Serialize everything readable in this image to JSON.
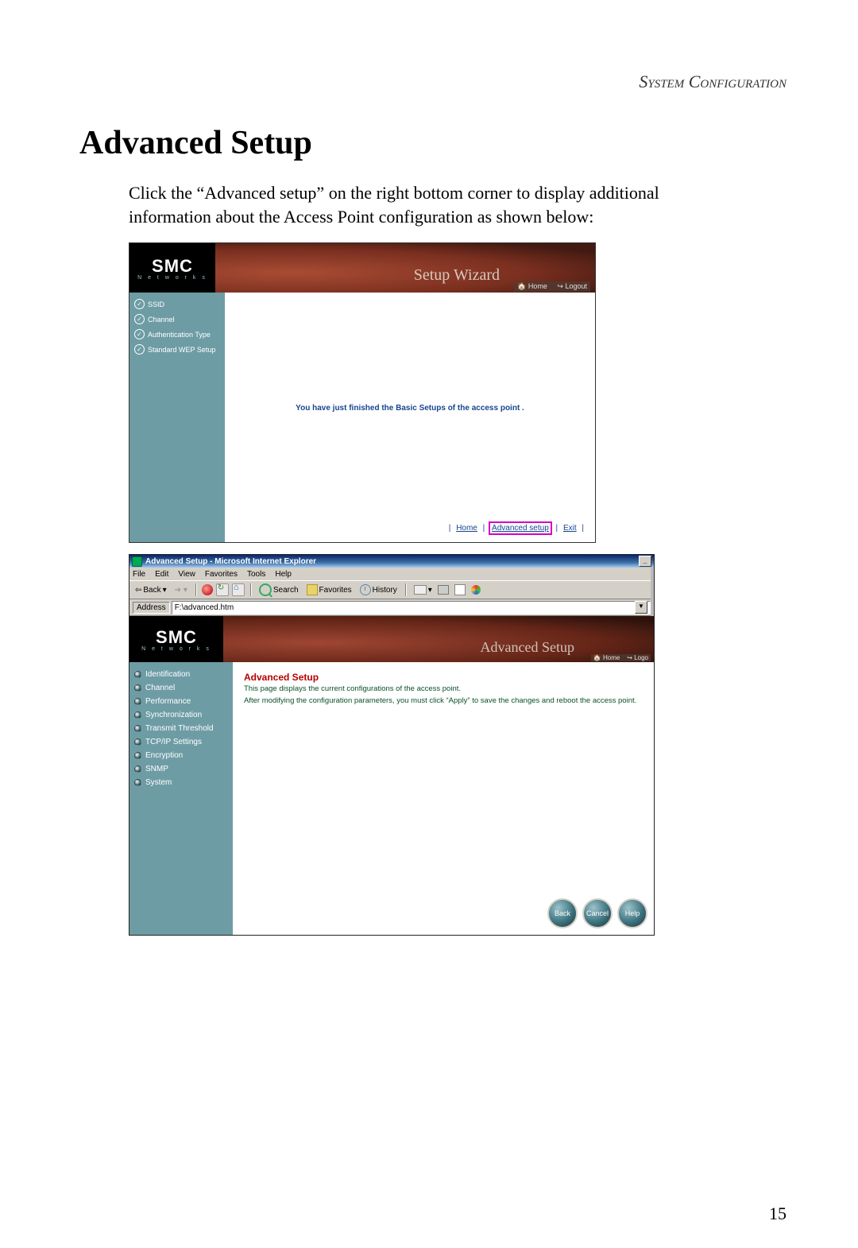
{
  "header": {
    "section": "System Configuration"
  },
  "title": "Advanced Setup",
  "intro": "Click the “Advanced setup” on the right bottom corner to display additional information about the Access Point configuration as shown below:",
  "page_number": "15",
  "shot1": {
    "logo": {
      "main": "SMC",
      "sub": "N e t w o r k s"
    },
    "banner_title": "Setup Wizard",
    "banner_home": "Home",
    "banner_logout": "Logout",
    "sidebar": {
      "items": [
        {
          "label": "SSID"
        },
        {
          "label": "Channel"
        },
        {
          "label": "Authentication Type"
        },
        {
          "label": "Standard WEP Setup"
        }
      ]
    },
    "message": "You have just finished the Basic Setups of the access point .",
    "footer": {
      "home": "Home",
      "advanced": "Advanced setup",
      "exit": "Exit"
    }
  },
  "shot2": {
    "window_title": "Advanced Setup - Microsoft Internet Explorer",
    "menu": {
      "file": "File",
      "edit": "Edit",
      "view": "View",
      "favorites": "Favorites",
      "tools": "Tools",
      "help": "Help"
    },
    "toolbar": {
      "back": "Back",
      "search": "Search",
      "favorites": "Favorites",
      "history": "History"
    },
    "address_label": "Address",
    "address_value": "F:\\advanced.htm",
    "logo": {
      "main": "SMC",
      "sub": "N e t w o r k s"
    },
    "banner_title": "Advanced Setup",
    "banner_home": "Home",
    "banner_logout": "Logo",
    "sidebar": {
      "items": [
        {
          "label": "Identification"
        },
        {
          "label": "Channel"
        },
        {
          "label": "Performance"
        },
        {
          "label": "Synchronization"
        },
        {
          "label": "Transmit Threshold"
        },
        {
          "label": "TCP/IP Settings"
        },
        {
          "label": "Encryption"
        },
        {
          "label": "SNMP"
        },
        {
          "label": "System"
        }
      ]
    },
    "content": {
      "heading": "Advanced Setup",
      "line1": "This page displays the current configurations of the access point.",
      "line2": "After modifying the configuration parameters, you must click “Apply” to save the changes and reboot the access point."
    },
    "buttons": {
      "back": "Back",
      "cancel": "Cancel",
      "help": "Help"
    }
  }
}
